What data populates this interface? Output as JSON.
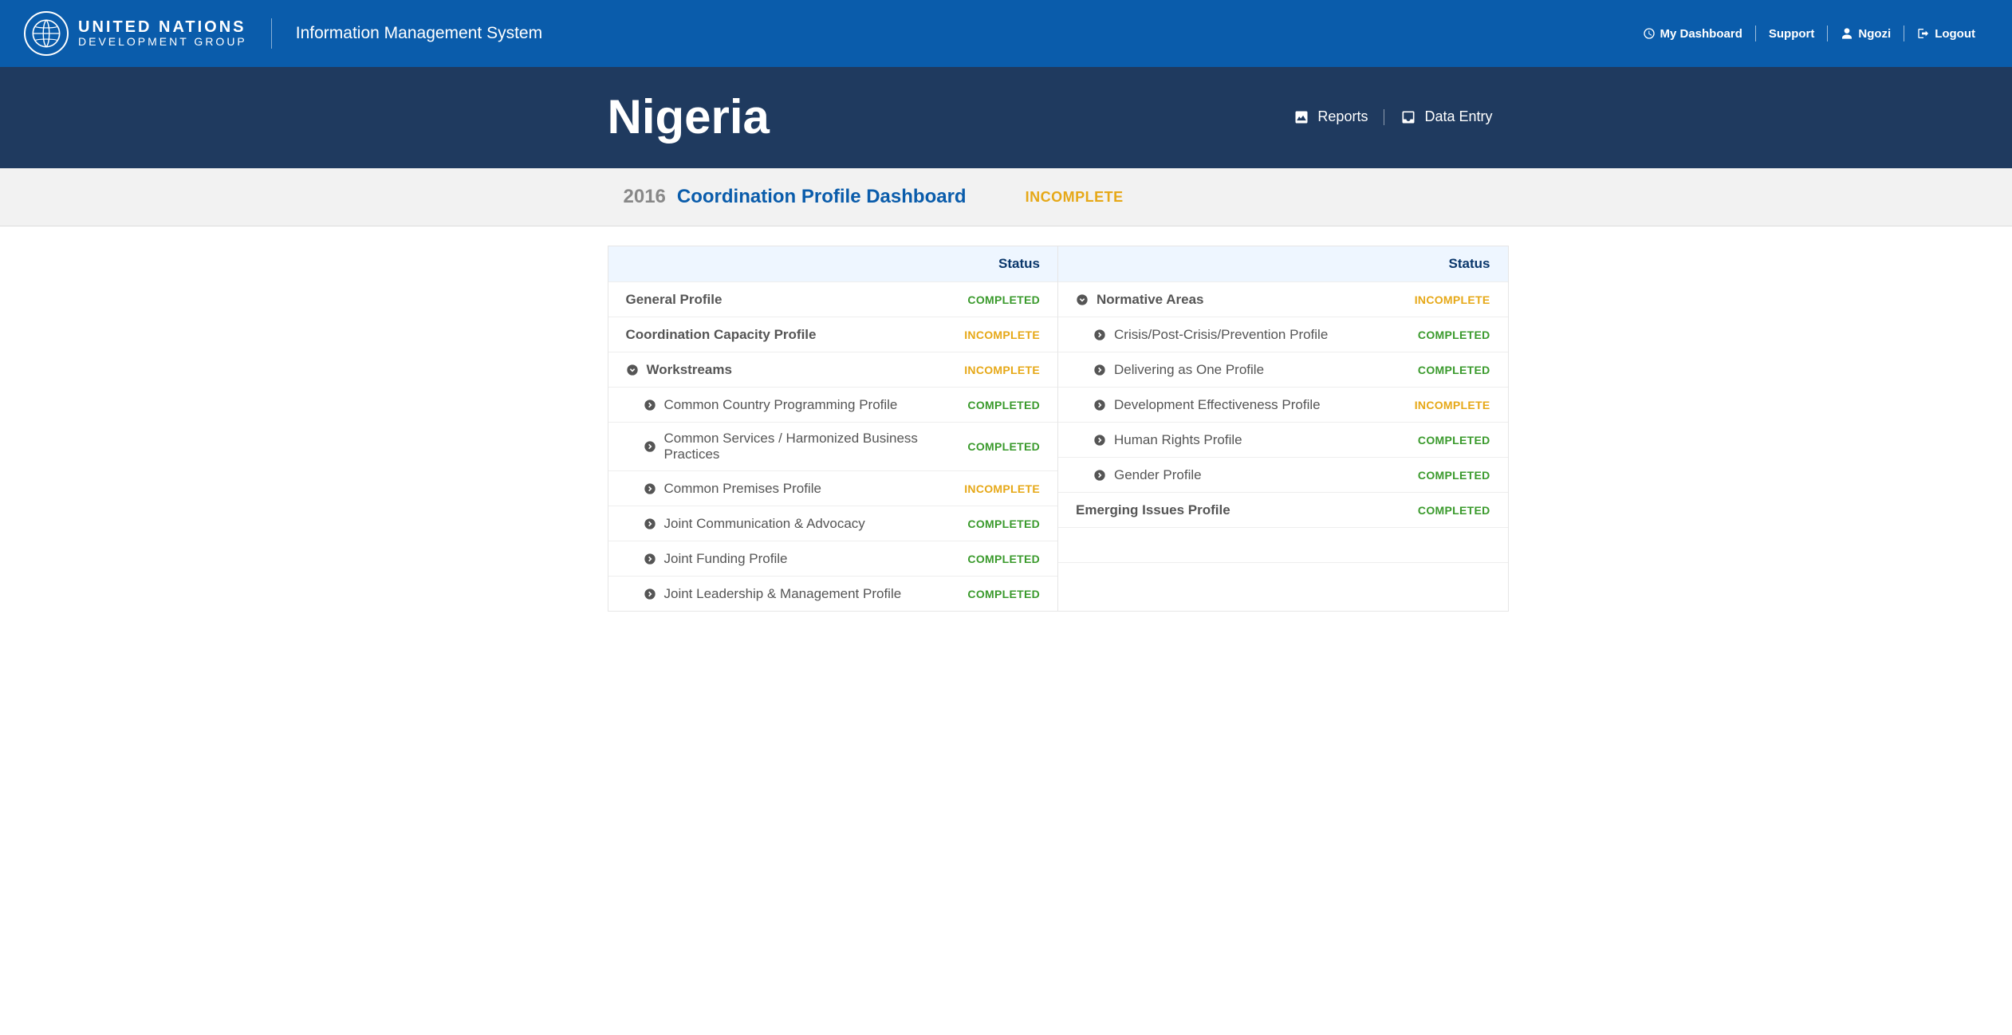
{
  "brand": {
    "line1": "UNITED NATIONS",
    "line2": "DEVELOPMENT GROUP",
    "subtitle": "Information Management System"
  },
  "topnav": {
    "dashboard": "My Dashboard",
    "support": "Support",
    "user": "Ngozi",
    "logout": "Logout"
  },
  "country": {
    "name": "Nigeria",
    "nav": {
      "reports": "Reports",
      "data_entry": "Data Entry"
    }
  },
  "page": {
    "year": "2016",
    "title": "Coordination Profile Dashboard",
    "status": "INCOMPLETE"
  },
  "statusHeader": "Status",
  "leftCol": [
    {
      "type": "section",
      "name": "General Profile",
      "status": "COMPLETED",
      "icon": "none"
    },
    {
      "type": "section",
      "name": "Coordination Capacity Profile",
      "status": "INCOMPLETE",
      "icon": "none"
    },
    {
      "type": "section",
      "name": "Workstreams",
      "status": "INCOMPLETE",
      "icon": "expand"
    },
    {
      "type": "child",
      "name": "Common Country Programming Profile",
      "status": "COMPLETED",
      "icon": "arrow"
    },
    {
      "type": "child",
      "name": "Common Services / Harmonized Business Practices",
      "status": "COMPLETED",
      "icon": "arrow"
    },
    {
      "type": "child",
      "name": "Common Premises Profile",
      "status": "INCOMPLETE",
      "icon": "arrow"
    },
    {
      "type": "child",
      "name": "Joint Communication & Advocacy",
      "status": "COMPLETED",
      "icon": "arrow"
    },
    {
      "type": "child",
      "name": "Joint Funding Profile",
      "status": "COMPLETED",
      "icon": "arrow"
    },
    {
      "type": "child",
      "name": "Joint Leadership & Management Profile",
      "status": "COMPLETED",
      "icon": "arrow"
    }
  ],
  "rightCol": [
    {
      "type": "section",
      "name": "Normative Areas",
      "status": "INCOMPLETE",
      "icon": "expand"
    },
    {
      "type": "child",
      "name": "Crisis/Post-Crisis/Prevention Profile",
      "status": "COMPLETED",
      "icon": "arrow"
    },
    {
      "type": "child",
      "name": "Delivering as One Profile",
      "status": "COMPLETED",
      "icon": "arrow"
    },
    {
      "type": "child",
      "name": "Development Effectiveness Profile",
      "status": "INCOMPLETE",
      "icon": "arrow"
    },
    {
      "type": "child",
      "name": "Human Rights Profile",
      "status": "COMPLETED",
      "icon": "arrow"
    },
    {
      "type": "child",
      "name": "Gender Profile",
      "status": "COMPLETED",
      "icon": "arrow"
    },
    {
      "type": "section",
      "name": "Emerging Issues Profile",
      "status": "COMPLETED",
      "icon": "none"
    },
    {
      "type": "empty"
    },
    {
      "type": "empty"
    }
  ]
}
